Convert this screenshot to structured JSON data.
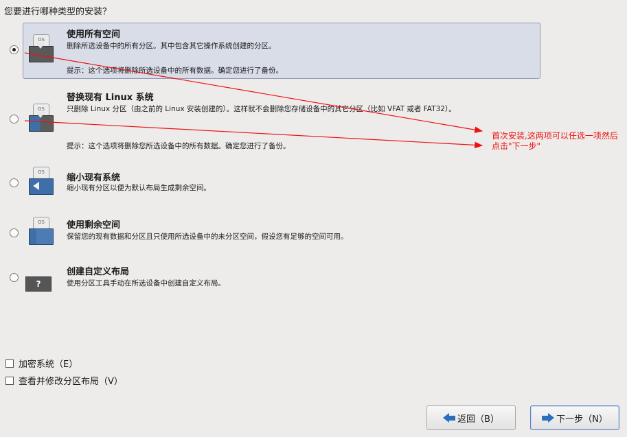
{
  "heading": "您要进行哪种类型的安装？",
  "options": [
    {
      "title": "使用所有空间",
      "desc": "删除所选设备中的所有分区。其中包含其它操作系统创建的分区。",
      "hint": "提示：这个选项将删除所选设备中的所有数据。确定您进行了备份。",
      "icon": "disk-erase-icon",
      "icon_label": "OS",
      "selected": true
    },
    {
      "title": "替换现有 Linux 系统",
      "desc": "只删除 Linux 分区（由之前的 Linux 安装创建的）。这样就不会删除您存储设备中的其它分区（比如 VFAT 或者 FAT32）。",
      "hint": "提示：这个选项将删除您所选设备中的所有数据。确定您进行了备份。",
      "icon": "disk-replace-icon",
      "icon_label": "OS",
      "selected": false
    },
    {
      "title": "缩小现有系统",
      "desc": "缩小现有分区以便为默认布局生成剩余空间。",
      "icon": "disk-shrink-icon",
      "icon_label": "OS",
      "selected": false
    },
    {
      "title": "使用剩余空间",
      "desc": "保留您的现有数据和分区且只使用所选设备中的未分区空间，假设您有足够的空间可用。",
      "icon": "disk-free-space-icon",
      "icon_label": "OS",
      "selected": false
    },
    {
      "title": "创建自定义布局",
      "desc": "使用分区工具手动在所选设备中创建自定义布局。",
      "icon": "custom-layout-icon",
      "icon_label": "?",
      "selected": false
    }
  ],
  "checkboxes": [
    {
      "label": "加密系统（E）",
      "checked": false
    },
    {
      "label": "查看并修改分区布局（V）",
      "checked": false
    }
  ],
  "buttons": {
    "back": "返回（B）",
    "next": "下一步（N）"
  },
  "annotation": {
    "text": "首次安装,这两项可以任选一项然后点击\"下一步\"",
    "color": "#e11111"
  }
}
